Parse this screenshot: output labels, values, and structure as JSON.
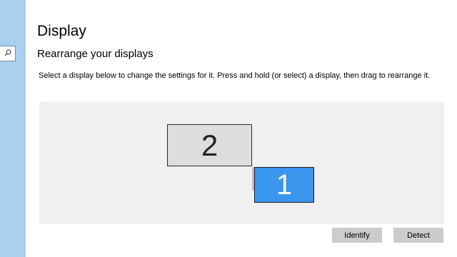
{
  "page": {
    "title": "Display",
    "section_title": "Rearrange your displays",
    "instructions": "Select a display below to change the settings for it. Press and hold (or select) a display, then drag to rearrange it."
  },
  "sidebar": {
    "search_icon": "search-icon"
  },
  "arrangement": {
    "monitors": [
      {
        "label": "2",
        "selected": false
      },
      {
        "label": "1",
        "selected": true
      }
    ],
    "colors": {
      "selected": "#3b96ee",
      "unselected": "#dddddd",
      "background": "#f0f0f0"
    }
  },
  "actions": {
    "identify_label": "Identify",
    "detect_label": "Detect"
  }
}
